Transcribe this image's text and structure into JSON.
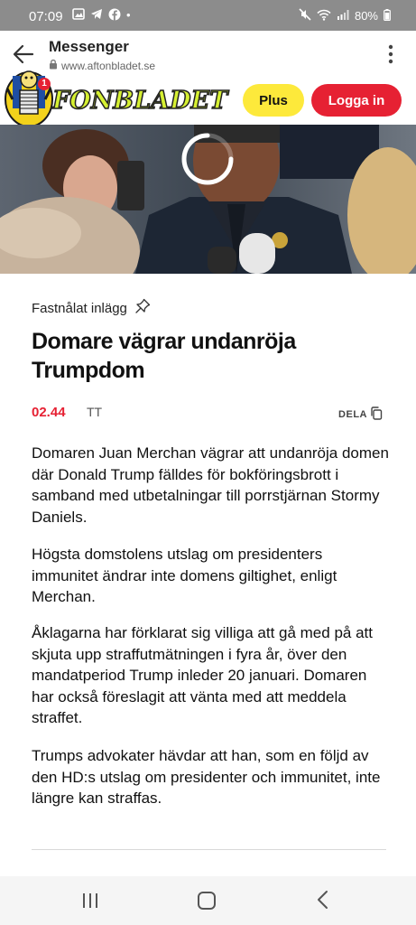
{
  "status_bar": {
    "time": "07:09",
    "battery": "80%",
    "left_icons": [
      "gallery-icon",
      "telegram-icon",
      "facebook-icon",
      "dot-icon"
    ],
    "right_icons": [
      "mute-icon",
      "wifi-icon",
      "signal-icon",
      "battery-icon"
    ]
  },
  "app_bar": {
    "title": "Messenger",
    "url": "www.aftonbladet.se",
    "back_icon": "arrow-left-icon",
    "menu_icon": "kebab-menu-icon"
  },
  "site_header": {
    "logo_text": "FONBLADET",
    "plus_label": "Plus",
    "login_label": "Logga in",
    "notification_badge": "1",
    "colors": {
      "plus": "#fde93b",
      "login": "#e62133"
    }
  },
  "article": {
    "pinned_label": "Fastnålat inlägg",
    "headline": "Domare vägrar undanröja Trumpdom",
    "time": "02.44",
    "source": "TT",
    "share_label": "DELA",
    "paragraphs": [
      "Domaren Juan Merchan vägrar att undanröja domen där Donald Trump fälldes för bokföringsbrott i samband med utbetalningar till porrstjärnan Stormy Daniels.",
      "Högsta domstolens utslag om presidenters immunitet ändrar inte domens giltighet, enligt Merchan.",
      "Åklagarna har förklarat sig villiga att gå med på att skjuta upp straffutmätningen i fyra år, över den mandatperiod Trump inleder 20 januari. Domaren har också föreslagit att vänta med att meddela straffet.",
      "Trumps advokater hävdar att han, som en följd av den HD:s utslag om presidenter och immunitet, inte längre kan straffas."
    ]
  },
  "nav_bar": {
    "icons": [
      "recent-apps-icon",
      "home-icon",
      "back-icon"
    ]
  }
}
